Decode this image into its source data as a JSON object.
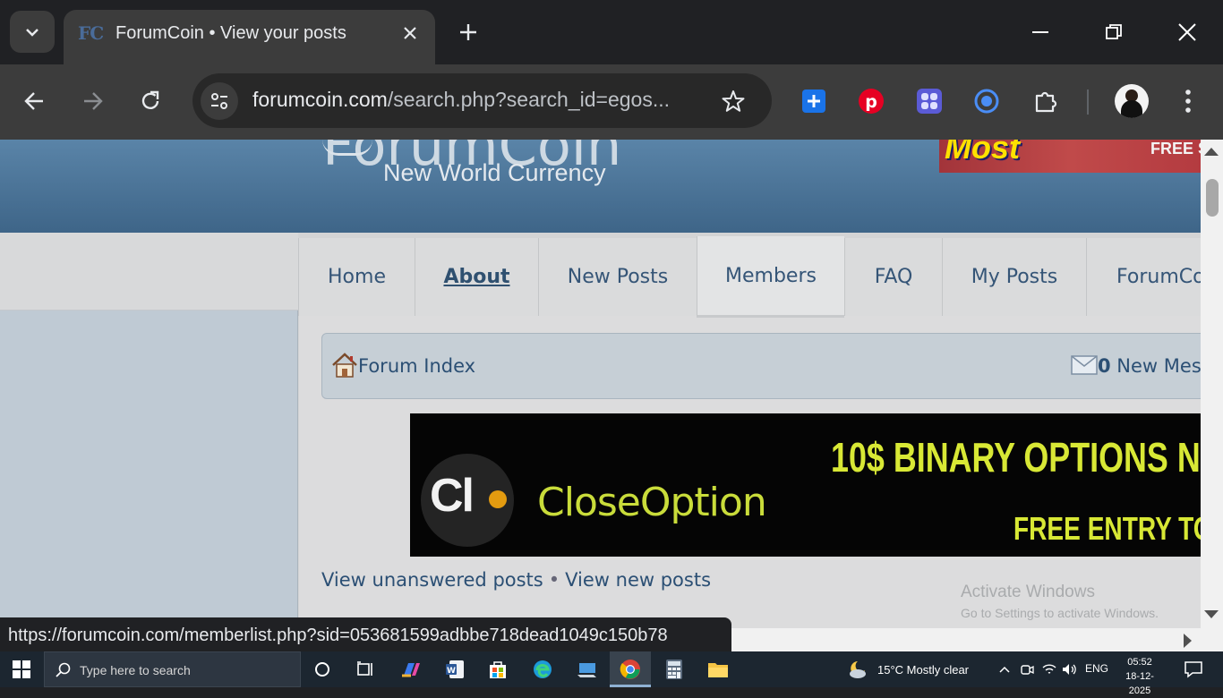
{
  "browser": {
    "tab": {
      "favicon_text": "FC",
      "title": "ForumCoin • View your posts"
    },
    "address": {
      "host": "forumcoin.com",
      "path": "/search.php?search_id=egos..."
    },
    "status_url": "https://forumcoin.com/memberlist.php?sid=053681599adbbe718dead1049c150b78"
  },
  "site": {
    "logo_text": "ForumCoin",
    "tagline": "New World Currency",
    "top_ad": {
      "mark": "Most",
      "text": "FREE S"
    },
    "nav": [
      "Home",
      "About",
      "New Posts",
      "Members",
      "FAQ",
      "My Posts",
      "ForumCo"
    ],
    "breadcrumb": {
      "index_label": "Forum Index",
      "messages_count": "0",
      "messages_label": " New Mess"
    },
    "ad": {
      "logo": "Cl",
      "brand": "CloseOption",
      "headline": "10$ BINARY OPTIONS NO",
      "subline": "FREE ENTRY TO W"
    },
    "links": {
      "unanswered": "View unanswered posts",
      "separator": "•",
      "new": "View new posts"
    }
  },
  "watermark": {
    "line1": "Activate Windows",
    "line2": "Go to Settings to activate Windows."
  },
  "taskbar": {
    "search_placeholder": "Type here to search",
    "weather": "15°C  Mostly clear",
    "language": "ENG",
    "time": "05:52",
    "date": "18-12-2025"
  },
  "colors": {
    "banner": "#4a7298",
    "link": "#2b4f74",
    "ad_accent": "#d8e835"
  }
}
